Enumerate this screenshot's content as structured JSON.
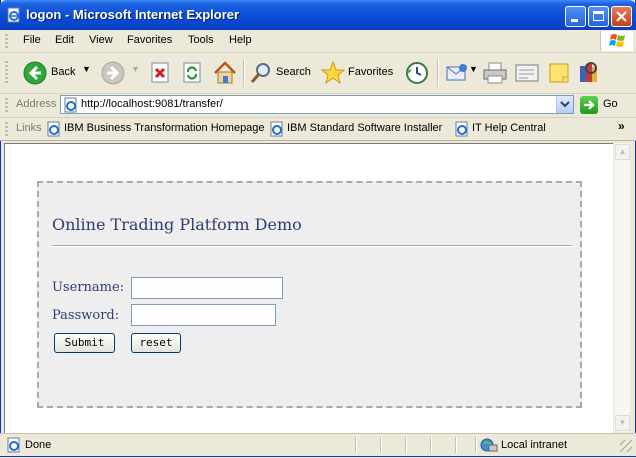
{
  "window": {
    "title": "logon - Microsoft Internet Explorer"
  },
  "menu": {
    "items": [
      {
        "label": "File"
      },
      {
        "label": "Edit"
      },
      {
        "label": "View"
      },
      {
        "label": "Favorites"
      },
      {
        "label": "Tools"
      },
      {
        "label": "Help"
      }
    ]
  },
  "toolbar": {
    "back_label": "Back",
    "search_label": "Search",
    "favorites_label": "Favorites",
    "icons": [
      "back-icon",
      "forward-icon",
      "stop-icon",
      "refresh-icon",
      "home-icon",
      "search-icon",
      "favorites-star-icon",
      "history-icon",
      "mail-icon",
      "print-icon",
      "edit-icon",
      "discuss-icon",
      "research-icon"
    ]
  },
  "address": {
    "label": "Address",
    "url": "http://localhost:9081/transfer/",
    "go_label": "Go"
  },
  "links": {
    "label": "Links",
    "items": [
      {
        "label": "IBM Business Transformation Homepage"
      },
      {
        "label": "IBM Standard Software Installer"
      },
      {
        "label": "IT Help Central"
      }
    ],
    "chevron": "»"
  },
  "page": {
    "heading": "Online Trading Platform Demo",
    "username_label": "Username:",
    "username_value": "",
    "password_label": "Password:",
    "password_value": "",
    "submit_label": "Submit",
    "reset_label": "reset"
  },
  "status": {
    "text": "Done",
    "zone": "Local intranet"
  },
  "colors": {
    "title_bar": "#0a4fd6",
    "heading_text": "#303c78",
    "form_background": "#eeeeee"
  }
}
